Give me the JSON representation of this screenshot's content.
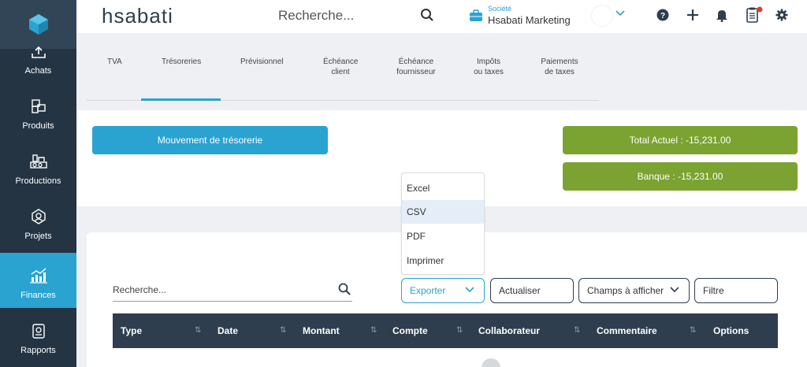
{
  "header": {
    "brand": "hsabati",
    "search_placeholder": "Recherche...",
    "company_label": "Société",
    "company_name": "Hsabati Marketing"
  },
  "sidebar": {
    "items": [
      {
        "label": "Achats",
        "icon": "upload-icon"
      },
      {
        "label": "Produits",
        "icon": "boxes-icon"
      },
      {
        "label": "Productions",
        "icon": "factory-icon"
      },
      {
        "label": "Projets",
        "icon": "project-icon"
      },
      {
        "label": "Finances",
        "icon": "chart-icon",
        "active": true
      },
      {
        "label": "Rapports",
        "icon": "report-icon"
      }
    ]
  },
  "tabs": {
    "items": [
      {
        "label": "TVA"
      },
      {
        "label": "Trésoreries",
        "active": true
      },
      {
        "label": "Prévisionnel"
      },
      {
        "label": "Échéance client"
      },
      {
        "label": "Échéance fournisseur"
      },
      {
        "label": "Impôts ou taxes"
      },
      {
        "label": "Paiements de taxes"
      }
    ]
  },
  "treasury": {
    "movement_button": "Mouvement de trésorerie",
    "total_actuel": "Total Actuel : -15,231.00",
    "banque": "Banque : -15,231.00"
  },
  "table_controls": {
    "search_placeholder": "Recherche...",
    "export_label": "Exporter",
    "refresh_label": "Actualiser",
    "fields_label": "Champs à afficher",
    "filter_label": "Filtre"
  },
  "export_menu": {
    "items": [
      "Excel",
      "CSV",
      "PDF",
      "Imprimer"
    ],
    "highlighted": "CSV"
  },
  "table": {
    "columns": [
      "Type",
      "Date",
      "Montant",
      "Compte",
      "Collaborateur",
      "Commentaire",
      "Options"
    ]
  },
  "colors": {
    "accent": "#2aa3d1",
    "sidebar": "#243443",
    "positive_box": "#7aa331",
    "table_header": "#2f3e4e",
    "notification_dot": "#e53935"
  }
}
